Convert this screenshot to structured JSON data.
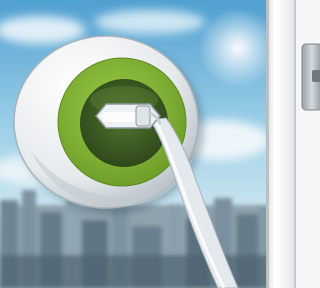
{
  "scene": {
    "subject": "window-socket-illustration",
    "colors": {
      "sky_top": "#4f9fd0",
      "sky_mid": "#a9d6ea",
      "city": "#7f97a6",
      "socket_body": "#eef1f3",
      "socket_ring": "#86b83a",
      "socket_inner": "#3e5a22",
      "plug": "#e9ecee",
      "cable": "#e3e8ec",
      "frame": "#f2f2f2",
      "handle": "#b7bec3"
    }
  }
}
